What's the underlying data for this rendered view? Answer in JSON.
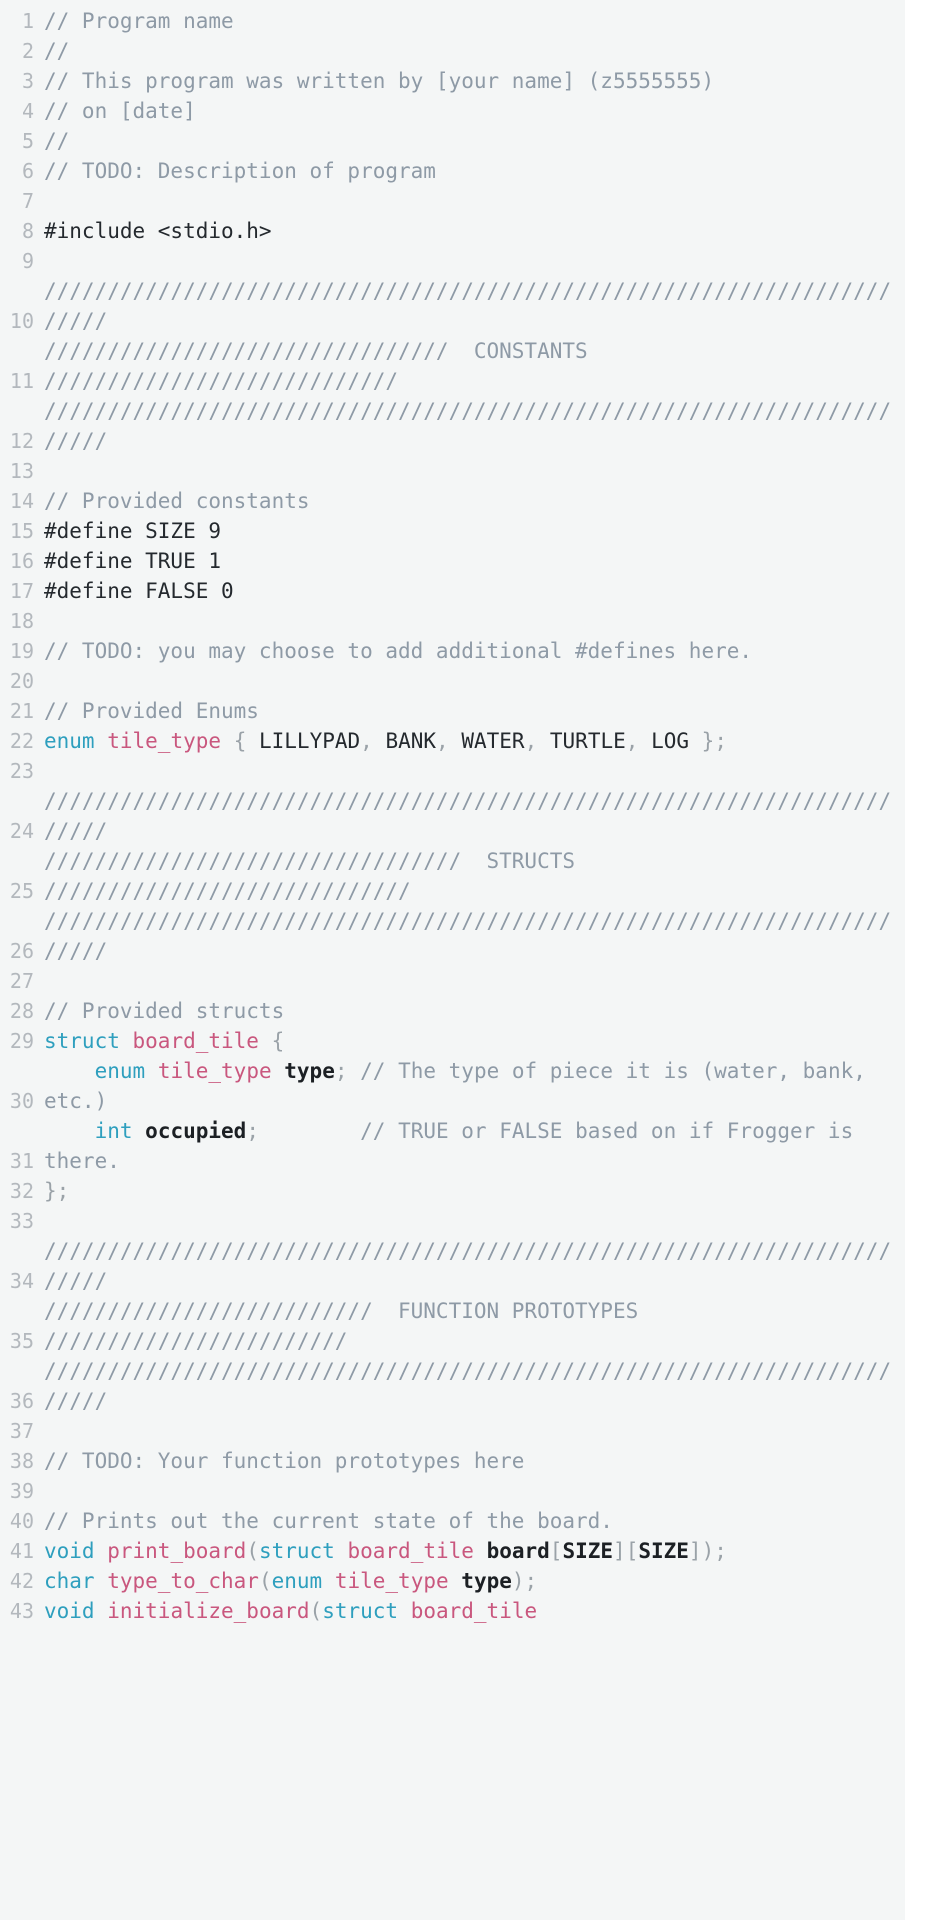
{
  "editor": {
    "language": "C",
    "font_size_px": 21,
    "line_height_px": 30,
    "wrap": "soft-wrap enabled",
    "colors": {
      "background": "#f4f6f6",
      "page_background": "#ffffff",
      "gutter_text": "#b3b8bd",
      "default_text": "#24292e",
      "comment": "#8e9aa6",
      "keyword": "#2e9fbe",
      "type_name": "#c9577e",
      "function_name": "#c9577e",
      "identifier": "#1c2024",
      "punctuation": "#9aa2a8"
    }
  },
  "lines": [
    {
      "number": "1",
      "text": "// Program name"
    },
    {
      "number": "2",
      "text": "//"
    },
    {
      "number": "3",
      "text": "// This program was written by [your name] (z5555555)"
    },
    {
      "number": "4",
      "text": "// on [date]"
    },
    {
      "number": "5",
      "text": "//"
    },
    {
      "number": "6",
      "text": "// TODO: Description of program"
    },
    {
      "number": "7",
      "text": ""
    },
    {
      "number": "8",
      "text": "#include <stdio.h>"
    },
    {
      "number": "9",
      "text": ""
    },
    {
      "number": "10",
      "text": "////////////////////////////////////////////////////////////////////////"
    },
    {
      "number": "11",
      "text": "////////////////////////////////  CONSTANTS  ////////////////////////////"
    },
    {
      "number": "12",
      "text": "////////////////////////////////////////////////////////////////////////"
    },
    {
      "number": "13",
      "text": ""
    },
    {
      "number": "14",
      "text": "// Provided constants"
    },
    {
      "number": "15",
      "text": "#define SIZE 9"
    },
    {
      "number": "16",
      "text": "#define TRUE 1"
    },
    {
      "number": "17",
      "text": "#define FALSE 0"
    },
    {
      "number": "18",
      "text": ""
    },
    {
      "number": "19",
      "text": "// TODO: you may choose to add additional #defines here."
    },
    {
      "number": "20",
      "text": ""
    },
    {
      "number": "21",
      "text": "// Provided Enums"
    },
    {
      "number": "22",
      "text": "enum tile_type { LILLYPAD, BANK, WATER, TURTLE, LOG };"
    },
    {
      "number": "23",
      "text": ""
    },
    {
      "number": "24",
      "text": "////////////////////////////////////////////////////////////////////////"
    },
    {
      "number": "25",
      "text": "/////////////////////////////////  STRUCTS  /////////////////////////////"
    },
    {
      "number": "26",
      "text": "////////////////////////////////////////////////////////////////////////"
    },
    {
      "number": "27",
      "text": ""
    },
    {
      "number": "28",
      "text": "// Provided structs"
    },
    {
      "number": "29",
      "text": "struct board_tile {"
    },
    {
      "number": "30",
      "text": "    enum tile_type type; // The type of piece it is (water, bank, etc.)"
    },
    {
      "number": "31",
      "text": "    int occupied;        // TRUE or FALSE based on if Frogger is there."
    },
    {
      "number": "32",
      "text": "};"
    },
    {
      "number": "33",
      "text": ""
    },
    {
      "number": "34",
      "text": "////////////////////////////////////////////////////////////////////////"
    },
    {
      "number": "35",
      "text": "//////////////////////////  FUNCTION PROTOTYPES  ////////////////////////"
    },
    {
      "number": "36",
      "text": "////////////////////////////////////////////////////////////////////////"
    },
    {
      "number": "37",
      "text": ""
    },
    {
      "number": "38",
      "text": "// TODO: Your function prototypes here"
    },
    {
      "number": "39",
      "text": ""
    },
    {
      "number": "40",
      "text": "// Prints out the current state of the board."
    },
    {
      "number": "41",
      "text": "void print_board(struct board_tile board[SIZE][SIZE]);"
    },
    {
      "number": "42",
      "text": "char type_to_char(enum tile_type type);"
    },
    {
      "number": "43",
      "text": "void initialize_board(struct board_tile"
    }
  ],
  "tokens": {
    "comment_prefix": "//",
    "keywords": [
      "enum",
      "struct",
      "int",
      "void",
      "char"
    ],
    "type_names": [
      "tile_type",
      "board_tile"
    ],
    "function_names": [
      "print_board",
      "type_to_char",
      "initialize_board"
    ],
    "identifiers": [
      "type",
      "occupied",
      "board",
      "SIZE"
    ],
    "enum_members": [
      "LILLYPAD",
      "BANK",
      "WATER",
      "TURTLE",
      "LOG"
    ],
    "defines": [
      "SIZE 9",
      "TRUE 1",
      "FALSE 0"
    ],
    "include": "#include <stdio.h>"
  }
}
